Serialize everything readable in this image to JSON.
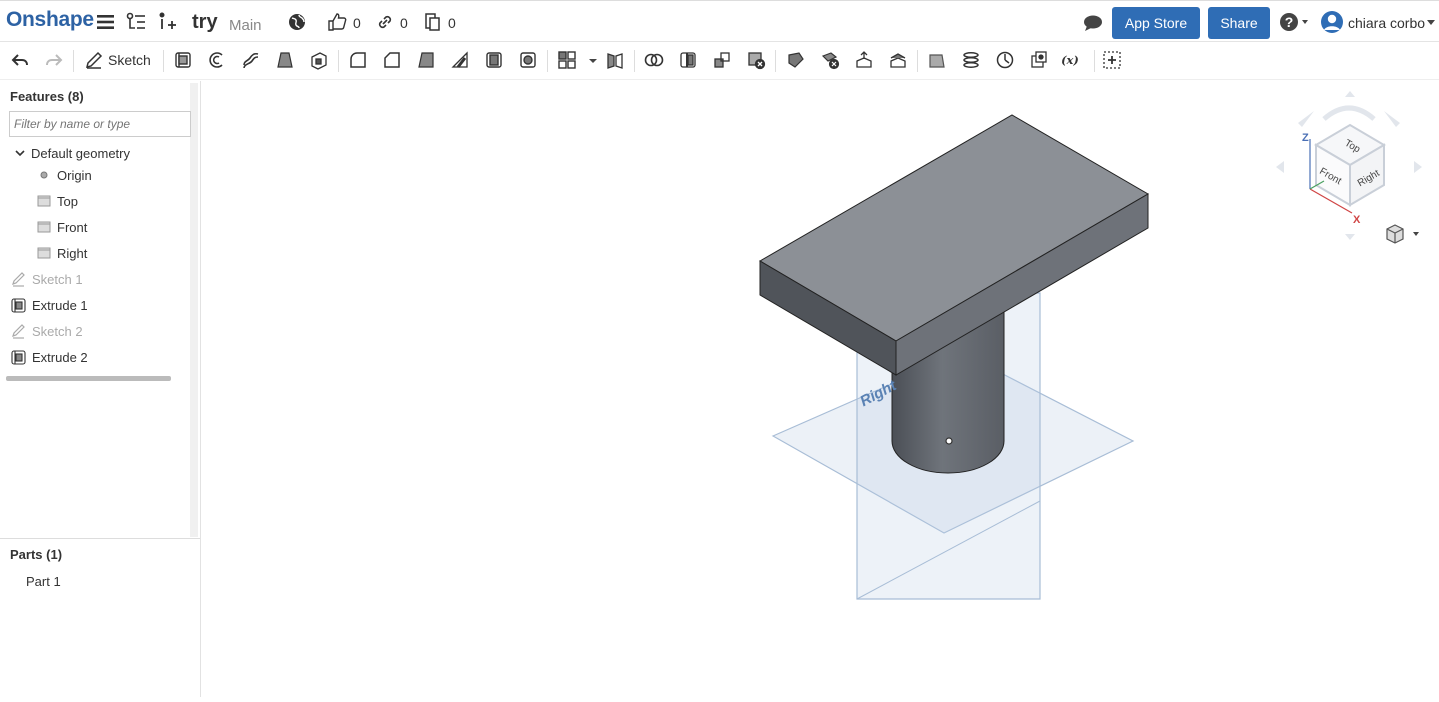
{
  "app": {
    "logo": "Onshape"
  },
  "document": {
    "title": "try",
    "branch": "Main"
  },
  "counters": {
    "likes": "0",
    "links": "0",
    "copies": "0"
  },
  "header": {
    "app_store": "App Store",
    "share": "Share",
    "user": "chiara corbo"
  },
  "toolbar": {
    "sketch_label": "Sketch"
  },
  "features": {
    "heading": "Features (8)",
    "filter_placeholder": "Filter by name or type",
    "items": [
      {
        "label": "Default geometry",
        "icon": "chevron-down-icon"
      },
      {
        "label": "Origin",
        "icon": "origin-icon"
      },
      {
        "label": "Top",
        "icon": "plane-icon"
      },
      {
        "label": "Front",
        "icon": "plane-icon"
      },
      {
        "label": "Right",
        "icon": "plane-icon"
      },
      {
        "label": "Sketch 1",
        "icon": "sketch-icon"
      },
      {
        "label": "Extrude 1",
        "icon": "extrude-icon"
      },
      {
        "label": "Sketch 2",
        "icon": "sketch-icon"
      },
      {
        "label": "Extrude 2",
        "icon": "extrude-icon"
      }
    ]
  },
  "parts": {
    "heading": "Parts (1)",
    "items": [
      {
        "label": "Part 1"
      }
    ]
  },
  "viewport": {
    "plane_label": "Right",
    "view_cube": {
      "top": "Top",
      "front": "Front",
      "right": "Right",
      "axis_z": "Z",
      "axis_x": "X"
    }
  },
  "colors": {
    "brand": "#2d62a4",
    "button": "#2f6db5",
    "plane": "#b9cde3"
  }
}
